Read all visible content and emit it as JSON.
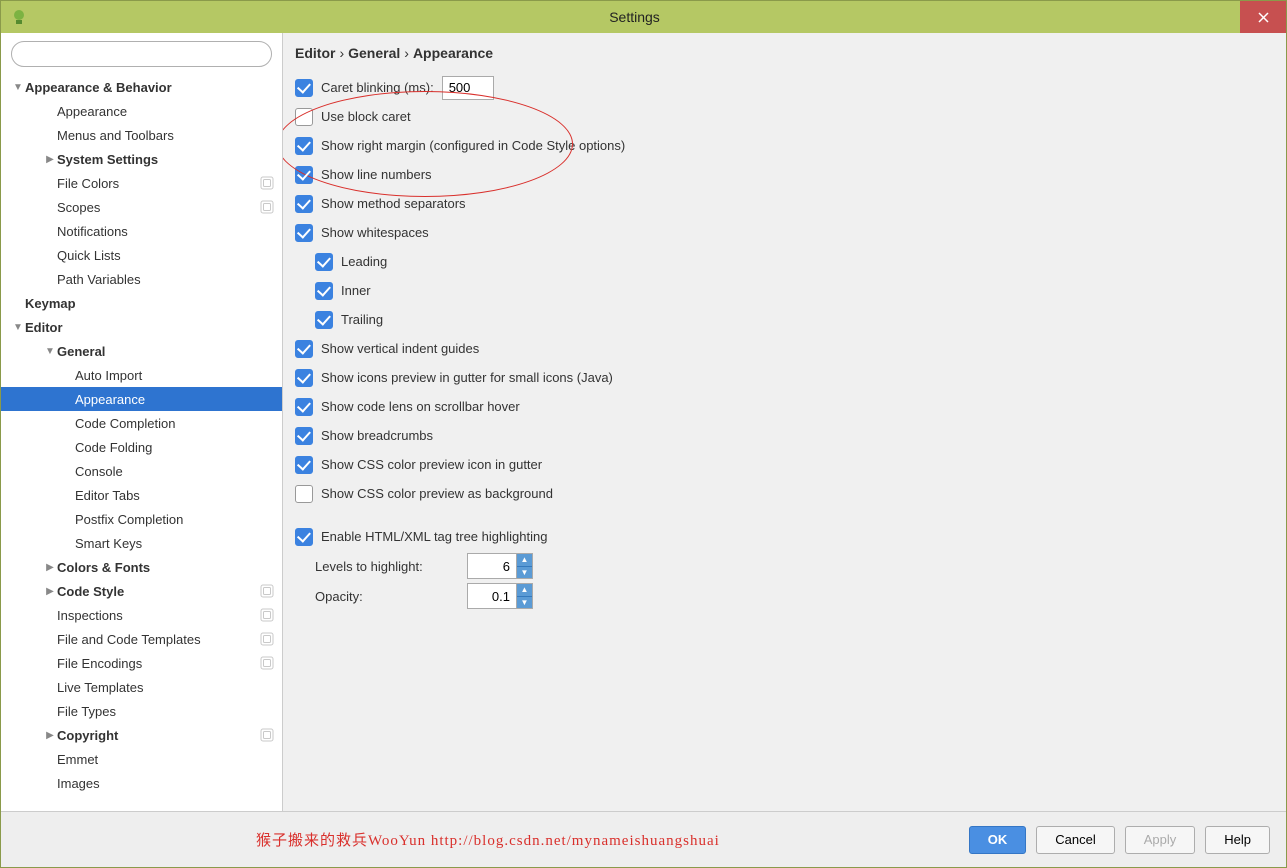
{
  "title": "Settings",
  "breadcrumb": [
    "Editor",
    "General",
    "Appearance"
  ],
  "sidebar": [
    {
      "label": "Appearance & Behavior",
      "depth": 0,
      "bold": true,
      "arrow": "down"
    },
    {
      "label": "Appearance",
      "depth": 1
    },
    {
      "label": "Menus and Toolbars",
      "depth": 1
    },
    {
      "label": "System Settings",
      "depth": 1,
      "bold": true,
      "arrow": "right"
    },
    {
      "label": "File Colors",
      "depth": 1,
      "badge": true
    },
    {
      "label": "Scopes",
      "depth": 1,
      "badge": true
    },
    {
      "label": "Notifications",
      "depth": 1
    },
    {
      "label": "Quick Lists",
      "depth": 1
    },
    {
      "label": "Path Variables",
      "depth": 1
    },
    {
      "label": "Keymap",
      "depth": 0,
      "bold": true
    },
    {
      "label": "Editor",
      "depth": 0,
      "bold": true,
      "arrow": "down"
    },
    {
      "label": "General",
      "depth": 1,
      "bold": true,
      "arrow": "down"
    },
    {
      "label": "Auto Import",
      "depth": 2
    },
    {
      "label": "Appearance",
      "depth": 2,
      "selected": true
    },
    {
      "label": "Code Completion",
      "depth": 2
    },
    {
      "label": "Code Folding",
      "depth": 2
    },
    {
      "label": "Console",
      "depth": 2
    },
    {
      "label": "Editor Tabs",
      "depth": 2
    },
    {
      "label": "Postfix Completion",
      "depth": 2
    },
    {
      "label": "Smart Keys",
      "depth": 2
    },
    {
      "label": "Colors & Fonts",
      "depth": 1,
      "bold": true,
      "arrow": "right"
    },
    {
      "label": "Code Style",
      "depth": 1,
      "bold": true,
      "arrow": "right",
      "badge": true
    },
    {
      "label": "Inspections",
      "depth": 1,
      "badge": true
    },
    {
      "label": "File and Code Templates",
      "depth": 1,
      "badge": true
    },
    {
      "label": "File Encodings",
      "depth": 1,
      "badge": true
    },
    {
      "label": "Live Templates",
      "depth": 1
    },
    {
      "label": "File Types",
      "depth": 1
    },
    {
      "label": "Copyright",
      "depth": 1,
      "bold": true,
      "arrow": "right",
      "badge": true
    },
    {
      "label": "Emmet",
      "depth": 1
    },
    {
      "label": "Images",
      "depth": 1
    }
  ],
  "options": {
    "caret_blinking_label": "Caret blinking (ms):",
    "caret_blinking_value": "500",
    "use_block_caret": "Use block caret",
    "show_right_margin": "Show right margin (configured in Code Style options)",
    "show_line_numbers": "Show line numbers",
    "show_method_separators": "Show method separators",
    "show_whitespaces": "Show whitespaces",
    "ws_leading": "Leading",
    "ws_inner": "Inner",
    "ws_trailing": "Trailing",
    "show_vertical_guides": "Show vertical indent guides",
    "show_icons_preview": "Show icons preview in gutter for small icons (Java)",
    "show_code_lens": "Show code lens on scrollbar hover",
    "show_breadcrumbs": "Show breadcrumbs",
    "show_css_gutter": "Show CSS color preview icon in gutter",
    "show_css_background": "Show CSS color preview as background",
    "enable_html_tree": "Enable HTML/XML tag tree highlighting",
    "levels_label": "Levels to highlight:",
    "levels_value": "6",
    "opacity_label": "Opacity:",
    "opacity_value": "0.1"
  },
  "buttons": {
    "ok": "OK",
    "cancel": "Cancel",
    "apply": "Apply",
    "help": "Help"
  },
  "watermark": "猴子搬来的救兵WooYun http://blog.csdn.net/mynameishuangshuai"
}
